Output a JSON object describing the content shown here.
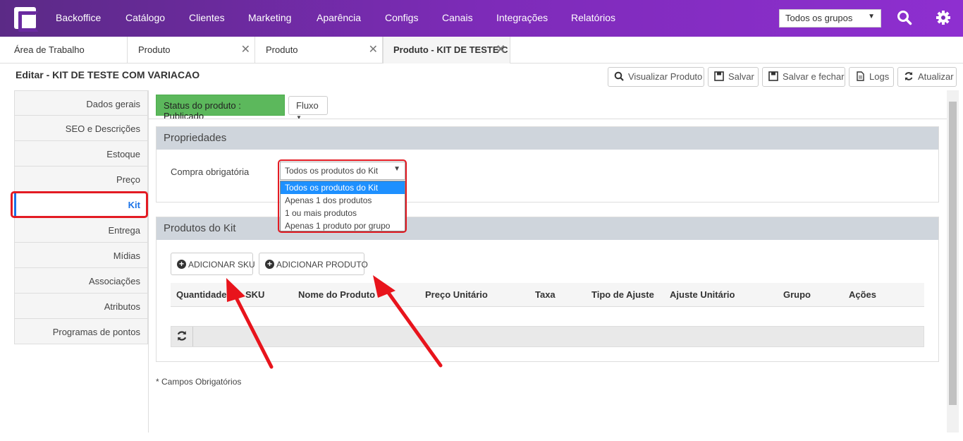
{
  "topbar": {
    "nav": [
      "Backoffice",
      "Catálogo",
      "Clientes",
      "Marketing",
      "Aparência",
      "Configs",
      "Canais",
      "Integrações",
      "Relatórios"
    ],
    "group_select": "Todos os grupos"
  },
  "tabs": [
    {
      "label": "Área de Trabalho"
    },
    {
      "label": "Produto"
    },
    {
      "label": "Produto"
    },
    {
      "label": "Produto - KIT DE TESTE C"
    }
  ],
  "page_title": "Editar - KIT DE TESTE COM VARIACAO",
  "toolbar": {
    "view": "Visualizar Produto",
    "save": "Salvar",
    "save_close": "Salvar e fechar",
    "logs": "Logs",
    "refresh": "Atualizar"
  },
  "sidebar": {
    "items": [
      "Dados gerais",
      "SEO e Descrições",
      "Estoque",
      "Preço",
      "Kit",
      "Entrega",
      "Mídias",
      "Associações",
      "Atributos",
      "Programas de pontos"
    ]
  },
  "status": {
    "label": "Status do produto : Publicado",
    "flow": "Fluxo"
  },
  "properties": {
    "title": "Propriedades",
    "field_label": "Compra obrigatória",
    "selected": "Todos os produtos do Kit",
    "options": [
      "Todos os produtos do Kit",
      "Apenas 1 dos produtos",
      "1 ou mais produtos",
      "Apenas 1 produto por grupo"
    ]
  },
  "kit_products": {
    "title": "Produtos do Kit",
    "add_sku": "ADICIONAR SKU",
    "add_product": "ADICIONAR PRODUTO",
    "columns": [
      "Quantidade",
      "SKU",
      "Nome do Produto",
      "Preço Unitário",
      "Taxa",
      "Tipo de Ajuste",
      "Ajuste Unitário",
      "Grupo",
      "Ações"
    ]
  },
  "footnote": "* Campos Obrigatórios",
  "colors": {
    "brand": "#7d2bb8",
    "status_green": "#5cb85c",
    "highlight_red": "#e31b23",
    "active_blue": "#1a73e8"
  }
}
